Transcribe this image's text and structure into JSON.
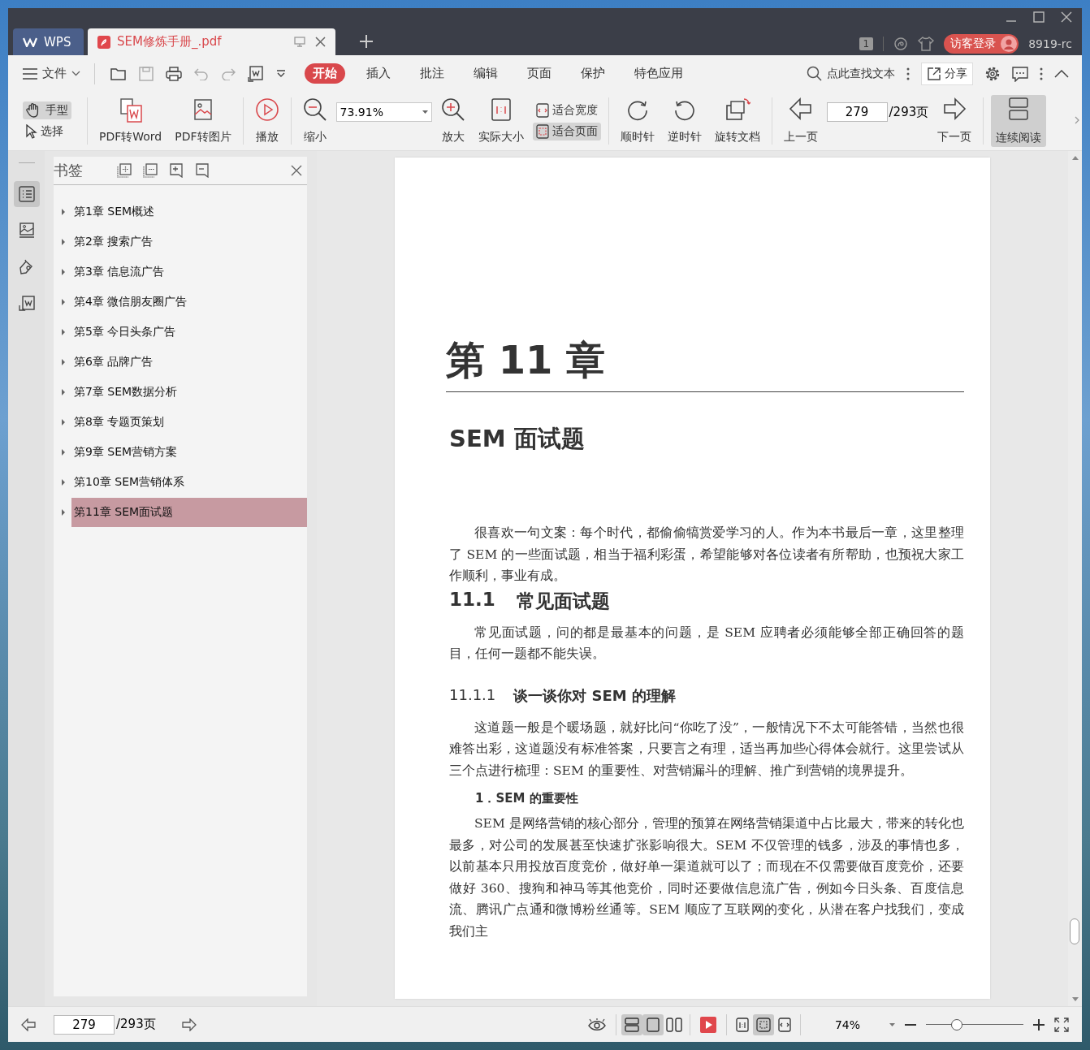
{
  "tabs": [
    {
      "label": "WPS",
      "kind": "home",
      "selected": false
    },
    {
      "label": "SEM修炼手册_.pdf",
      "kind": "document",
      "selected": true
    }
  ],
  "title_bar": {
    "window_count": "1",
    "login": "访客登录",
    "user": "8919-rc"
  },
  "menu": {
    "file": "文件",
    "items": [
      {
        "label": "开始",
        "selected": true
      },
      {
        "label": "插入",
        "selected": false
      },
      {
        "label": "批注",
        "selected": false
      },
      {
        "label": "编辑",
        "selected": false
      },
      {
        "label": "页面",
        "selected": false
      },
      {
        "label": "保护",
        "selected": false
      },
      {
        "label": "特色应用",
        "selected": false
      }
    ],
    "search": "点此查找文本",
    "share": "分享"
  },
  "toolbar": {
    "modes": [
      {
        "label": "手型",
        "selected": true
      },
      {
        "label": "选择",
        "selected": false
      }
    ],
    "convert": [
      "PDF转Word",
      "PDF转图片"
    ],
    "play": "播放",
    "zoom_out": "缩小",
    "zoom_value": "73.91%",
    "zoom_in": "放大",
    "actual_size": "实际大小",
    "fit": [
      {
        "label": "适合宽度",
        "selected": false
      },
      {
        "label": "适合页面",
        "selected": true
      }
    ],
    "rotate": [
      "顺时针",
      "逆时针",
      "旋转文档"
    ],
    "prev_page": "上一页",
    "page": "279",
    "page_total": "/293页",
    "next_page": "下一页",
    "continuous": {
      "label": "连续阅读",
      "selected": true
    }
  },
  "side_tabs": [
    {
      "selected": true
    },
    {
      "selected": false
    },
    {
      "selected": false
    },
    {
      "selected": false
    }
  ],
  "bookmarks": {
    "title": "书签",
    "items": [
      {
        "label": "第1章 SEM概述",
        "expanded": false,
        "selected": false
      },
      {
        "label": "第2章 搜索广告",
        "expanded": false,
        "selected": false
      },
      {
        "label": "第3章 信息流广告",
        "expanded": false,
        "selected": false
      },
      {
        "label": "第4章 微信朋友圈广告",
        "expanded": false,
        "selected": false
      },
      {
        "label": "第5章 今日头条广告",
        "expanded": false,
        "selected": false
      },
      {
        "label": "第6章 品牌广告",
        "expanded": false,
        "selected": false
      },
      {
        "label": "第7章 SEM数据分析",
        "expanded": false,
        "selected": false
      },
      {
        "label": "第8章 专题页策划",
        "expanded": false,
        "selected": false
      },
      {
        "label": "第9章 SEM营销方案",
        "expanded": false,
        "selected": false
      },
      {
        "label": "第10章 SEM营销体系",
        "expanded": false,
        "selected": false
      },
      {
        "label": "第11章 SEM面试题",
        "expanded": false,
        "selected": true
      }
    ]
  },
  "document_page": {
    "chapter": "第 11 章",
    "title": "SEM 面试题",
    "blocks": [
      {
        "kind": "paragraph",
        "text": "很喜欢一句文案：每个时代，都偷偷犒赏爱学习的人。作为本书最后一章，这里整理了 SEM 的一些面试题，相当于福利彩蛋，希望能够对各位读者有所帮助，也预祝大家工作顺利，事业有成。"
      },
      {
        "kind": "section",
        "number": "11.1",
        "text": "常见面试题"
      },
      {
        "kind": "paragraph",
        "text": "常见面试题，问的都是最基本的问题，是 SEM 应聘者必须能够全部正确回答的题目，任何一题都不能失误。"
      },
      {
        "kind": "subsection",
        "number": "11.1.1",
        "text": "谈一谈你对 SEM 的理解"
      },
      {
        "kind": "paragraph",
        "text": "这道题一般是个暖场题，就好比问“你吃了没”，一般情况下不太可能答错，当然也很难答出彩，这道题没有标准答案，只要言之有理，适当再加些心得体会就行。这里尝试从三个点进行梳理：SEM 的重要性、对营销漏斗的理解、推广到营销的境界提升。"
      },
      {
        "kind": "point",
        "text": "1．SEM 的重要性"
      },
      {
        "kind": "paragraph",
        "text": "SEM 是网络营销的核心部分，管理的预算在网络营销渠道中占比最大，带来的转化也最多，对公司的发展甚至快速扩张影响很大。SEM 不仅管理的钱多，涉及的事情也多，以前基本只用投放百度竞价，做好单一渠道就可以了；而现在不仅需要做百度竞价，还要做好 360、搜狗和神马等其他竞价，同时还要做信息流广告，例如今日头条、百度信息流、腾讯广点通和微博粉丝通等。SEM 顺应了互联网的变化，从潜在客户找我们，变成我们主"
      }
    ]
  },
  "status_bar": {
    "page": "279",
    "page_total": "/293页",
    "view_modes": [
      {
        "selected": true
      },
      {
        "selected": true
      },
      {
        "selected": false
      }
    ],
    "fit_modes": [
      {
        "selected": false
      },
      {
        "selected": true
      },
      {
        "selected": false
      }
    ],
    "zoom": "74%",
    "zoom_slider": {
      "level": 0.32
    }
  }
}
